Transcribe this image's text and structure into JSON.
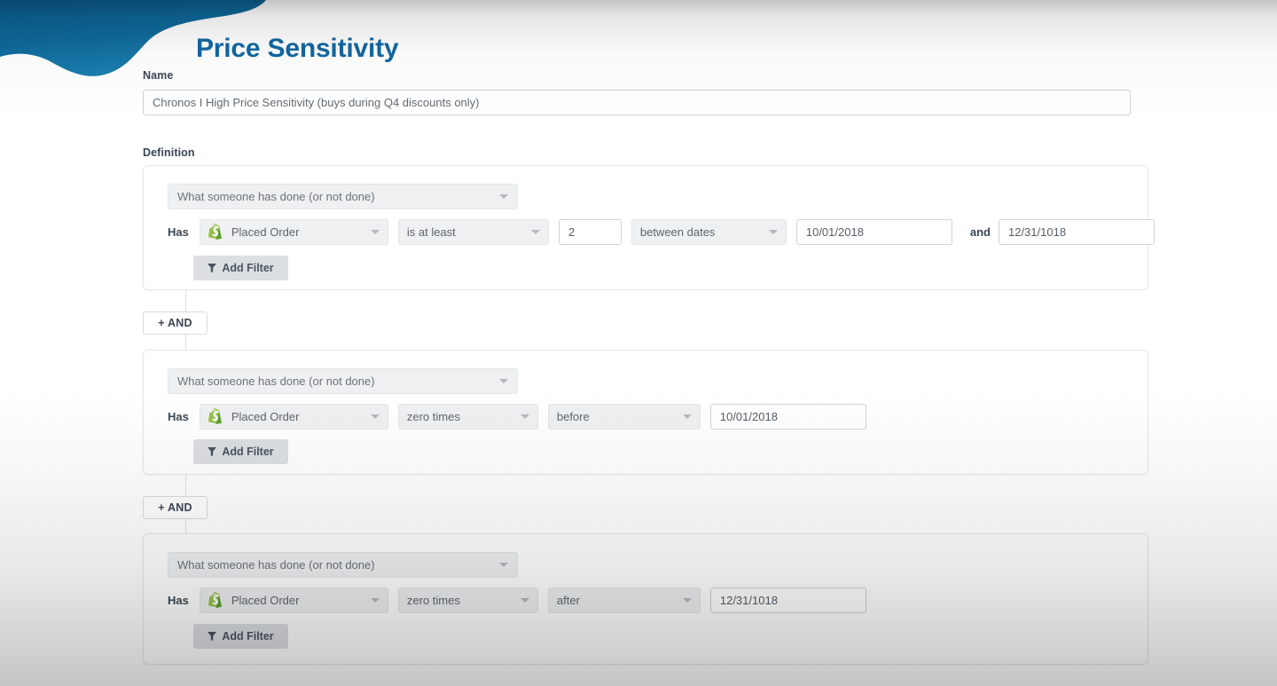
{
  "header": {
    "title": "Price Sensitivity",
    "title_color": "#1267a2",
    "wave_color_top": "#0b5c8e",
    "wave_color_bottom": "#1d7fb0"
  },
  "form": {
    "name_label": "Name",
    "name_value": "Chronos I High Price Sensitivity (buys during Q4 discounts only)",
    "definition_label": "Definition"
  },
  "and_buttons": [
    {
      "label": "+ AND"
    },
    {
      "label": "+ AND"
    }
  ],
  "conditions": [
    {
      "type_label": "What someone has done (or not done)",
      "has_label": "Has",
      "event_icon": "shopify-icon",
      "event_label": "Placed Order",
      "operator_label": "is at least",
      "count_value": "2",
      "timeframe_label": "between dates",
      "date_from": "10/01/2018",
      "conjunction_label": "and",
      "date_to": "12/31/1018",
      "add_filter_label": "Add Filter",
      "add_filter_icon": "funnel-icon"
    },
    {
      "type_label": "What someone has done (or not done)",
      "has_label": "Has",
      "event_icon": "shopify-icon",
      "event_label": "Placed Order",
      "operator_label": "zero times",
      "timeframe_label": "before",
      "date_from": "10/01/2018",
      "add_filter_label": "Add Filter",
      "add_filter_icon": "funnel-icon"
    },
    {
      "type_label": "What someone has done (or not done)",
      "has_label": "Has",
      "event_icon": "shopify-icon",
      "event_label": "Placed Order",
      "operator_label": "zero times",
      "timeframe_label": "after",
      "date_from": "12/31/1018",
      "add_filter_label": "Add Filter",
      "add_filter_icon": "funnel-icon"
    }
  ]
}
